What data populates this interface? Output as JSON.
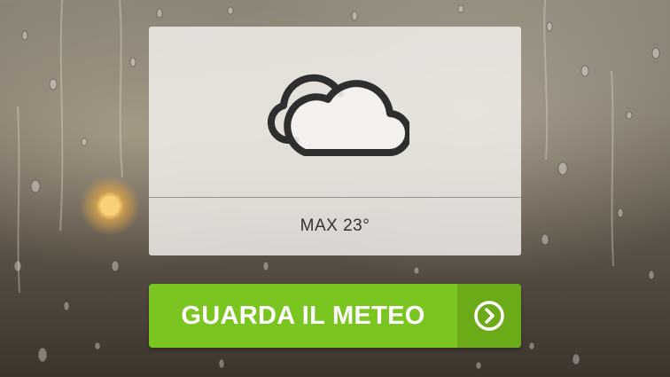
{
  "weather_card": {
    "icon": "partly-cloudy-icon",
    "max_temperature": "MAX 23°"
  },
  "cta_button": {
    "label": "GUARDA IL METEO",
    "icon": "chevron-right-circle-icon"
  },
  "colors": {
    "button_green": "#7bc521",
    "button_green_dark": "#6cab18",
    "card_background": "#f4f2ee",
    "icon_stroke": "#2e2e2e"
  }
}
